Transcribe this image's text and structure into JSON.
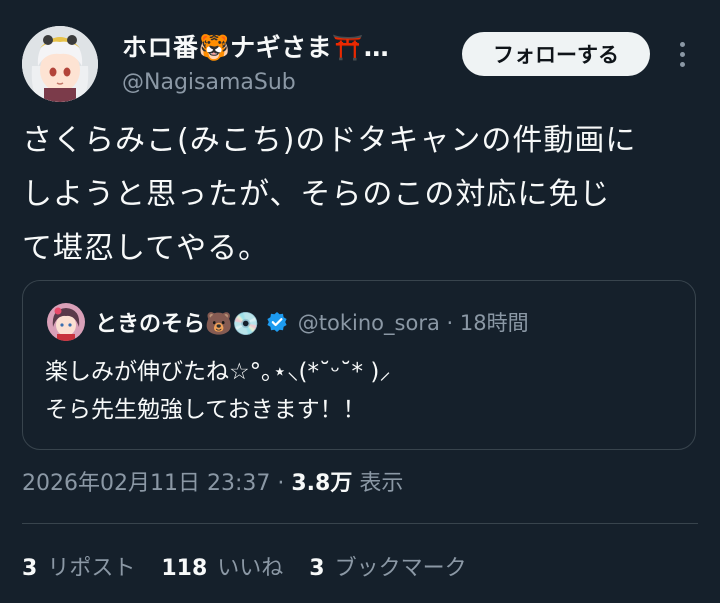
{
  "author": {
    "display_name": "ホロ番🐯ナギさま⛩️…",
    "handle": "@NagisamaSub"
  },
  "follow_label": "フォローする",
  "tweet": {
    "lines": [
      "さくらみこ(みこち)のドタキャンの件動画に",
      "しようと思ったが、そらのこの対応に免じ",
      "て堪忍してやる。"
    ]
  },
  "quote": {
    "name": "ときのそら🐻💿",
    "handle": "@tokino_sora · 18時間",
    "lines": [
      "楽しみが伸びたね☆°｡⋆⸜(*˘ᵕ˘* )⸝",
      "そら先生勉強しておきます！！"
    ]
  },
  "meta": {
    "timestamp": "2026年02月11日 23:37 · ",
    "views_count": "3.8万",
    "views_label": " 表示"
  },
  "stats": {
    "reposts_count": "3",
    "reposts_label": "リポスト",
    "likes_count": "118",
    "likes_label": "いいね",
    "bookmarks_count": "3",
    "bookmarks_label": "ブックマーク"
  },
  "colors": {
    "background": "#15202b",
    "text_primary": "#f7f9f9",
    "text_secondary": "#8b98a5",
    "border": "#38444d",
    "verified_blue": "#1d9bf0"
  }
}
